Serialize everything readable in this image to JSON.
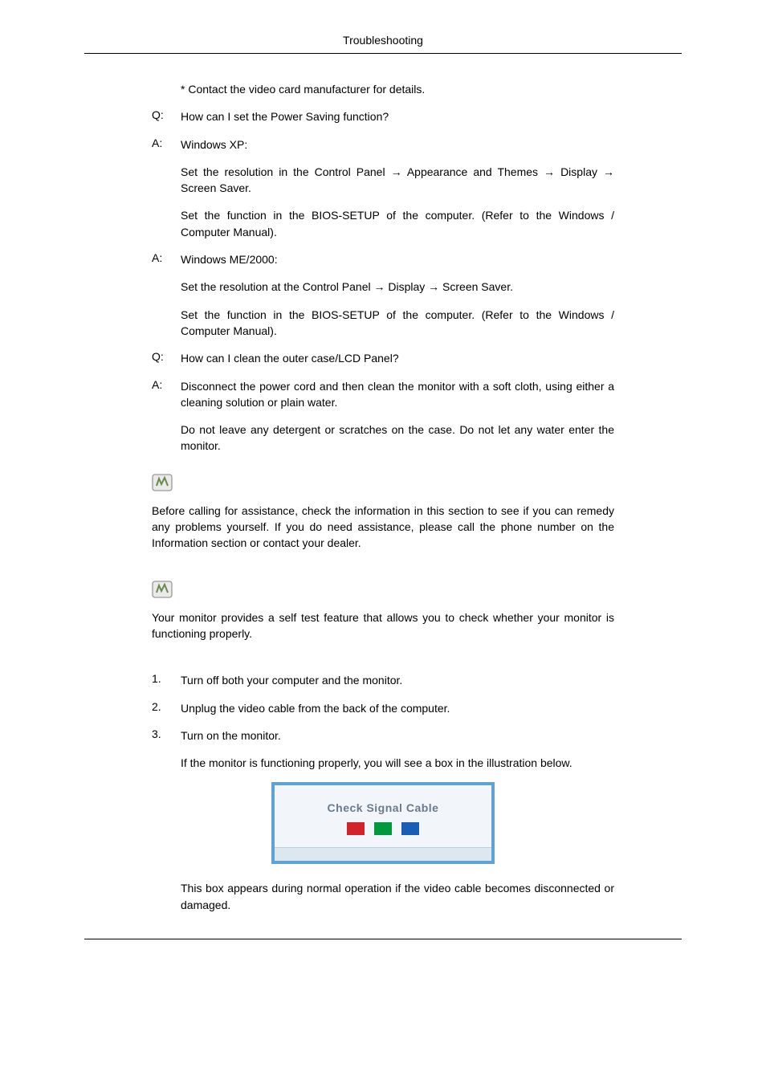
{
  "header": {
    "title": "Troubleshooting"
  },
  "qa": [
    {
      "label": "",
      "text": "* Contact the video card manufacturer for details.",
      "indent": true
    },
    {
      "label": "Q:",
      "text": "How can I set the Power Saving function?"
    },
    {
      "label": "A:",
      "text": "Windows XP:"
    },
    {
      "label": "",
      "text": "Set the resolution in the Control Panel → Appearance and Themes → Display → Screen Saver.",
      "indent": true
    },
    {
      "label": "",
      "text": "Set the function in the BIOS-SETUP of the computer. (Refer to the Windows / Computer Manual).",
      "indent": true
    },
    {
      "label": "A:",
      "text": "Windows ME/2000:"
    },
    {
      "label": "",
      "text": "Set the resolution at the Control Panel → Display → Screen Saver.",
      "indent": true
    },
    {
      "label": "",
      "text": "Set the function in the BIOS-SETUP of the computer. (Refer to the Windows / Computer Manual).",
      "indent": true
    },
    {
      "label": "Q:",
      "text": "How can I clean the outer case/LCD Panel?"
    },
    {
      "label": "A:",
      "text": "Disconnect the power cord and then clean the monitor with a soft cloth, using either a cleaning solution or plain water."
    },
    {
      "label": "",
      "text": "Do not leave any detergent or scratches on the case. Do not let any water enter the monitor.",
      "indent": true
    }
  ],
  "notes": {
    "note1": "Before calling for assistance, check the information in this section to see if you can remedy any problems yourself. If you do need assistance, please call the phone number on the Information section or contact your dealer.",
    "note2": "Your monitor provides a self test feature that allows you to check whether your monitor is functioning properly."
  },
  "steps": [
    {
      "num": "1.",
      "text": "Turn off both your computer and the monitor."
    },
    {
      "num": "2.",
      "text": "Unplug the video cable from the back of the computer."
    },
    {
      "num": "3.",
      "text": "Turn on the monitor."
    }
  ],
  "step3_followups": {
    "a": "If the monitor is functioning properly, you will see a box in the illustration below.",
    "b": "This box appears during normal operation if the video cable becomes disconnected or damaged."
  },
  "msgbox": {
    "title": "Check Signal Cable"
  },
  "colors": {
    "red": "#d2232a",
    "green": "#009a3d",
    "blue": "#1a5db6"
  }
}
